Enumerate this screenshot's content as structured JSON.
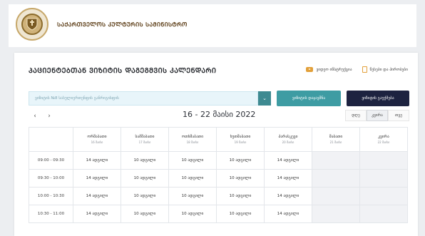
{
  "header": {
    "ministry_name": "ᲡᲐᲥᲐᲠᲗᲕᲔᲚᲝᲡ ᲙᲣᲚᲢᲣᲠᲘᲡ ᲡᲐᲛᲘᲜᲘᲡᲢᲠᲝ"
  },
  "page": {
    "title": "ᲞᲐᲪᲘᲔᲜᲢᲔᲑᲗᲐᲜ ᲕᲘᲖᲘᲢᲘᲡ ᲓᲐᲒᲔᲒᲛᲕᲘᲡ ᲙᲐᲚᲔᲜᲓᲐᲠᲘ",
    "links": [
      {
        "label": "ვიდეო ინსტრუქცია",
        "icon": "video-icon"
      },
      {
        "label": "წესები და პირობები",
        "icon": "document-icon"
      }
    ]
  },
  "toolbar": {
    "select_value": "ვიზიტის №8 სასულიერთენფის განრიგისფის",
    "btn_primary": "ვიზიტის დაჯავშნა",
    "btn_secondary": "ვიზიტის გაუქმება"
  },
  "calendar": {
    "range": "16 - 22 მაისი 2022",
    "views": [
      "დღე",
      "კვირა",
      "თვე"
    ],
    "active_view": 1,
    "days": [
      {
        "name": "ორშაბათი",
        "date": "16 მაისი",
        "available": true
      },
      {
        "name": "სამშაბათი",
        "date": "17 მაისი",
        "available": true
      },
      {
        "name": "ოთხშაბათი",
        "date": "18 მაისი",
        "available": true
      },
      {
        "name": "ხუთშაბათი",
        "date": "19 მაისი",
        "available": true
      },
      {
        "name": "პარასკევი",
        "date": "20 მაისი",
        "available": true
      },
      {
        "name": "შაბათი",
        "date": "21 მაისი",
        "available": false
      },
      {
        "name": "კვირა",
        "date": "22 მაისი",
        "available": false
      }
    ],
    "rows": [
      {
        "time": "09:00 - 09:30",
        "cells": [
          "14 ადგილი",
          "10 ადგილი",
          "10 ადგილი",
          "10 ადგილი",
          "14 ადგილი",
          "",
          ""
        ]
      },
      {
        "time": "09:30 - 10:00",
        "cells": [
          "14 ადგილი",
          "10 ადგილი",
          "10 ადგილი",
          "10 ადგილი",
          "14 ადგილი",
          "",
          ""
        ]
      },
      {
        "time": "10:00 - 10:30",
        "cells": [
          "14 ადგილი",
          "10 ადგილი",
          "10 ადგილი",
          "10 ადგილი",
          "14 ადგილი",
          "",
          ""
        ]
      },
      {
        "time": "10:30 - 11:00",
        "cells": [
          "14 ადგილი",
          "10 ადგილი",
          "10 ადგილი",
          "10 ადგილი",
          "14 ადგილი",
          "",
          ""
        ]
      }
    ]
  },
  "colors": {
    "accent_teal": "#3e9ca3",
    "accent_navy": "#1d2340",
    "brand_gold": "#c7a86a"
  }
}
